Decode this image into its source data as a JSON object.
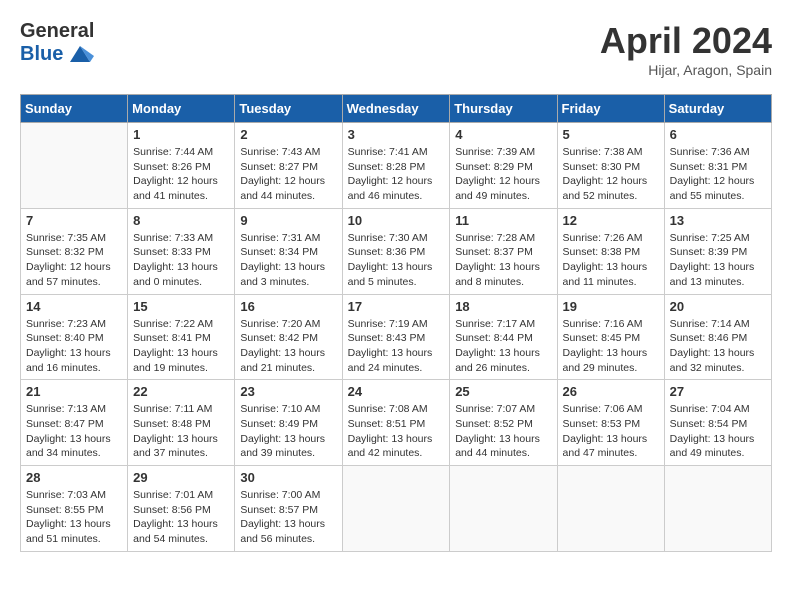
{
  "header": {
    "logo_general": "General",
    "logo_blue": "Blue",
    "month_title": "April 2024",
    "location": "Hijar, Aragon, Spain"
  },
  "weekdays": [
    "Sunday",
    "Monday",
    "Tuesday",
    "Wednesday",
    "Thursday",
    "Friday",
    "Saturday"
  ],
  "weeks": [
    [
      {
        "day": "",
        "sunrise": "",
        "sunset": "",
        "daylight": ""
      },
      {
        "day": "1",
        "sunrise": "Sunrise: 7:44 AM",
        "sunset": "Sunset: 8:26 PM",
        "daylight": "Daylight: 12 hours and 41 minutes."
      },
      {
        "day": "2",
        "sunrise": "Sunrise: 7:43 AM",
        "sunset": "Sunset: 8:27 PM",
        "daylight": "Daylight: 12 hours and 44 minutes."
      },
      {
        "day": "3",
        "sunrise": "Sunrise: 7:41 AM",
        "sunset": "Sunset: 8:28 PM",
        "daylight": "Daylight: 12 hours and 46 minutes."
      },
      {
        "day": "4",
        "sunrise": "Sunrise: 7:39 AM",
        "sunset": "Sunset: 8:29 PM",
        "daylight": "Daylight: 12 hours and 49 minutes."
      },
      {
        "day": "5",
        "sunrise": "Sunrise: 7:38 AM",
        "sunset": "Sunset: 8:30 PM",
        "daylight": "Daylight: 12 hours and 52 minutes."
      },
      {
        "day": "6",
        "sunrise": "Sunrise: 7:36 AM",
        "sunset": "Sunset: 8:31 PM",
        "daylight": "Daylight: 12 hours and 55 minutes."
      }
    ],
    [
      {
        "day": "7",
        "sunrise": "Sunrise: 7:35 AM",
        "sunset": "Sunset: 8:32 PM",
        "daylight": "Daylight: 12 hours and 57 minutes."
      },
      {
        "day": "8",
        "sunrise": "Sunrise: 7:33 AM",
        "sunset": "Sunset: 8:33 PM",
        "daylight": "Daylight: 13 hours and 0 minutes."
      },
      {
        "day": "9",
        "sunrise": "Sunrise: 7:31 AM",
        "sunset": "Sunset: 8:34 PM",
        "daylight": "Daylight: 13 hours and 3 minutes."
      },
      {
        "day": "10",
        "sunrise": "Sunrise: 7:30 AM",
        "sunset": "Sunset: 8:36 PM",
        "daylight": "Daylight: 13 hours and 5 minutes."
      },
      {
        "day": "11",
        "sunrise": "Sunrise: 7:28 AM",
        "sunset": "Sunset: 8:37 PM",
        "daylight": "Daylight: 13 hours and 8 minutes."
      },
      {
        "day": "12",
        "sunrise": "Sunrise: 7:26 AM",
        "sunset": "Sunset: 8:38 PM",
        "daylight": "Daylight: 13 hours and 11 minutes."
      },
      {
        "day": "13",
        "sunrise": "Sunrise: 7:25 AM",
        "sunset": "Sunset: 8:39 PM",
        "daylight": "Daylight: 13 hours and 13 minutes."
      }
    ],
    [
      {
        "day": "14",
        "sunrise": "Sunrise: 7:23 AM",
        "sunset": "Sunset: 8:40 PM",
        "daylight": "Daylight: 13 hours and 16 minutes."
      },
      {
        "day": "15",
        "sunrise": "Sunrise: 7:22 AM",
        "sunset": "Sunset: 8:41 PM",
        "daylight": "Daylight: 13 hours and 19 minutes."
      },
      {
        "day": "16",
        "sunrise": "Sunrise: 7:20 AM",
        "sunset": "Sunset: 8:42 PM",
        "daylight": "Daylight: 13 hours and 21 minutes."
      },
      {
        "day": "17",
        "sunrise": "Sunrise: 7:19 AM",
        "sunset": "Sunset: 8:43 PM",
        "daylight": "Daylight: 13 hours and 24 minutes."
      },
      {
        "day": "18",
        "sunrise": "Sunrise: 7:17 AM",
        "sunset": "Sunset: 8:44 PM",
        "daylight": "Daylight: 13 hours and 26 minutes."
      },
      {
        "day": "19",
        "sunrise": "Sunrise: 7:16 AM",
        "sunset": "Sunset: 8:45 PM",
        "daylight": "Daylight: 13 hours and 29 minutes."
      },
      {
        "day": "20",
        "sunrise": "Sunrise: 7:14 AM",
        "sunset": "Sunset: 8:46 PM",
        "daylight": "Daylight: 13 hours and 32 minutes."
      }
    ],
    [
      {
        "day": "21",
        "sunrise": "Sunrise: 7:13 AM",
        "sunset": "Sunset: 8:47 PM",
        "daylight": "Daylight: 13 hours and 34 minutes."
      },
      {
        "day": "22",
        "sunrise": "Sunrise: 7:11 AM",
        "sunset": "Sunset: 8:48 PM",
        "daylight": "Daylight: 13 hours and 37 minutes."
      },
      {
        "day": "23",
        "sunrise": "Sunrise: 7:10 AM",
        "sunset": "Sunset: 8:49 PM",
        "daylight": "Daylight: 13 hours and 39 minutes."
      },
      {
        "day": "24",
        "sunrise": "Sunrise: 7:08 AM",
        "sunset": "Sunset: 8:51 PM",
        "daylight": "Daylight: 13 hours and 42 minutes."
      },
      {
        "day": "25",
        "sunrise": "Sunrise: 7:07 AM",
        "sunset": "Sunset: 8:52 PM",
        "daylight": "Daylight: 13 hours and 44 minutes."
      },
      {
        "day": "26",
        "sunrise": "Sunrise: 7:06 AM",
        "sunset": "Sunset: 8:53 PM",
        "daylight": "Daylight: 13 hours and 47 minutes."
      },
      {
        "day": "27",
        "sunrise": "Sunrise: 7:04 AM",
        "sunset": "Sunset: 8:54 PM",
        "daylight": "Daylight: 13 hours and 49 minutes."
      }
    ],
    [
      {
        "day": "28",
        "sunrise": "Sunrise: 7:03 AM",
        "sunset": "Sunset: 8:55 PM",
        "daylight": "Daylight: 13 hours and 51 minutes."
      },
      {
        "day": "29",
        "sunrise": "Sunrise: 7:01 AM",
        "sunset": "Sunset: 8:56 PM",
        "daylight": "Daylight: 13 hours and 54 minutes."
      },
      {
        "day": "30",
        "sunrise": "Sunrise: 7:00 AM",
        "sunset": "Sunset: 8:57 PM",
        "daylight": "Daylight: 13 hours and 56 minutes."
      },
      {
        "day": "",
        "sunrise": "",
        "sunset": "",
        "daylight": ""
      },
      {
        "day": "",
        "sunrise": "",
        "sunset": "",
        "daylight": ""
      },
      {
        "day": "",
        "sunrise": "",
        "sunset": "",
        "daylight": ""
      },
      {
        "day": "",
        "sunrise": "",
        "sunset": "",
        "daylight": ""
      }
    ]
  ]
}
